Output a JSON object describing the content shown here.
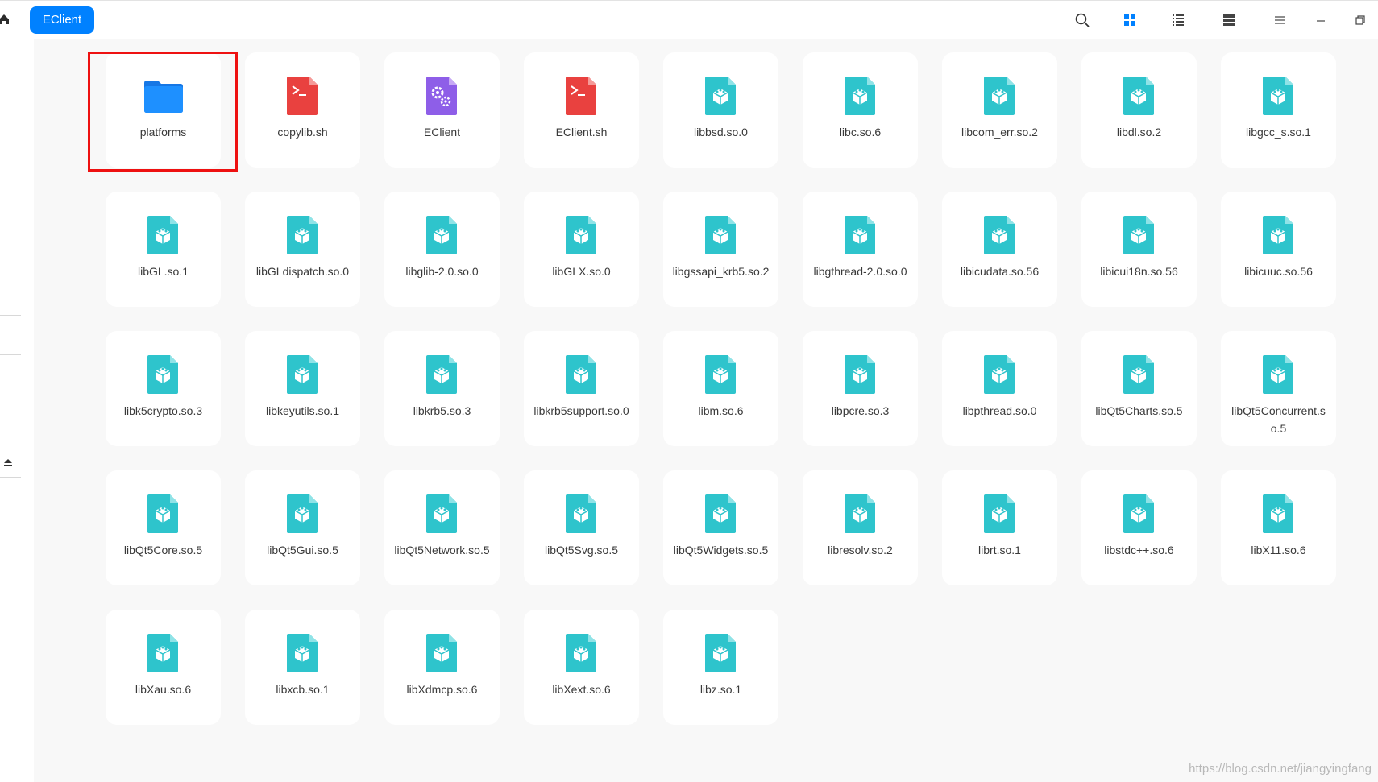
{
  "window": {
    "breadcrumb": "EClient",
    "toolbar_icons": [
      "search-icon",
      "icon-view-icon",
      "list-view-icon",
      "detail-view-icon",
      "menu-icon",
      "minimize-icon",
      "maximize-icon"
    ]
  },
  "colors": {
    "accent": "#0081ff",
    "folder": "#1e90ff",
    "library": "#2ec4cc",
    "script": "#e9413f",
    "executable": "#8e5ee8",
    "selection_frame": "#ee1111"
  },
  "files": [
    {
      "name": "platforms",
      "type": "folder",
      "selected": true
    },
    {
      "name": "copylib.sh",
      "type": "script"
    },
    {
      "name": "EClient",
      "type": "executable"
    },
    {
      "name": "EClient.sh",
      "type": "script"
    },
    {
      "name": "libbsd.so.0",
      "type": "library"
    },
    {
      "name": "libc.so.6",
      "type": "library"
    },
    {
      "name": "libcom_err.so.2",
      "type": "library"
    },
    {
      "name": "libdl.so.2",
      "type": "library"
    },
    {
      "name": "libgcc_s.so.1",
      "type": "library"
    },
    {
      "name": "libGL.so.1",
      "type": "library"
    },
    {
      "name": "libGLdispatch.so.0",
      "type": "library"
    },
    {
      "name": "libglib-2.0.so.0",
      "type": "library"
    },
    {
      "name": "libGLX.so.0",
      "type": "library"
    },
    {
      "name": "libgssapi_krb5.so.2",
      "type": "library"
    },
    {
      "name": "libgthread-2.0.so.0",
      "type": "library"
    },
    {
      "name": "libicudata.so.56",
      "type": "library"
    },
    {
      "name": "libicui18n.so.56",
      "type": "library"
    },
    {
      "name": "libicuuc.so.56",
      "type": "library"
    },
    {
      "name": "libk5crypto.so.3",
      "type": "library"
    },
    {
      "name": "libkeyutils.so.1",
      "type": "library"
    },
    {
      "name": "libkrb5.so.3",
      "type": "library"
    },
    {
      "name": "libkrb5support.so.0",
      "type": "library"
    },
    {
      "name": "libm.so.6",
      "type": "library"
    },
    {
      "name": "libpcre.so.3",
      "type": "library"
    },
    {
      "name": "libpthread.so.0",
      "type": "library"
    },
    {
      "name": "libQt5Charts.so.5",
      "type": "library"
    },
    {
      "name": "libQt5Concurrent.so.5",
      "type": "library"
    },
    {
      "name": "libQt5Core.so.5",
      "type": "library"
    },
    {
      "name": "libQt5Gui.so.5",
      "type": "library"
    },
    {
      "name": "libQt5Network.so.5",
      "type": "library"
    },
    {
      "name": "libQt5Svg.so.5",
      "type": "library"
    },
    {
      "name": "libQt5Widgets.so.5",
      "type": "library"
    },
    {
      "name": "libresolv.so.2",
      "type": "library"
    },
    {
      "name": "librt.so.1",
      "type": "library"
    },
    {
      "name": "libstdc++.so.6",
      "type": "library"
    },
    {
      "name": "libX11.so.6",
      "type": "library"
    },
    {
      "name": "libXau.so.6",
      "type": "library"
    },
    {
      "name": "libxcb.so.1",
      "type": "library"
    },
    {
      "name": "libXdmcp.so.6",
      "type": "library"
    },
    {
      "name": "libXext.so.6",
      "type": "library"
    },
    {
      "name": "libz.so.1",
      "type": "library"
    }
  ],
  "watermark": "https://blog.csdn.net/jiangyingfang"
}
